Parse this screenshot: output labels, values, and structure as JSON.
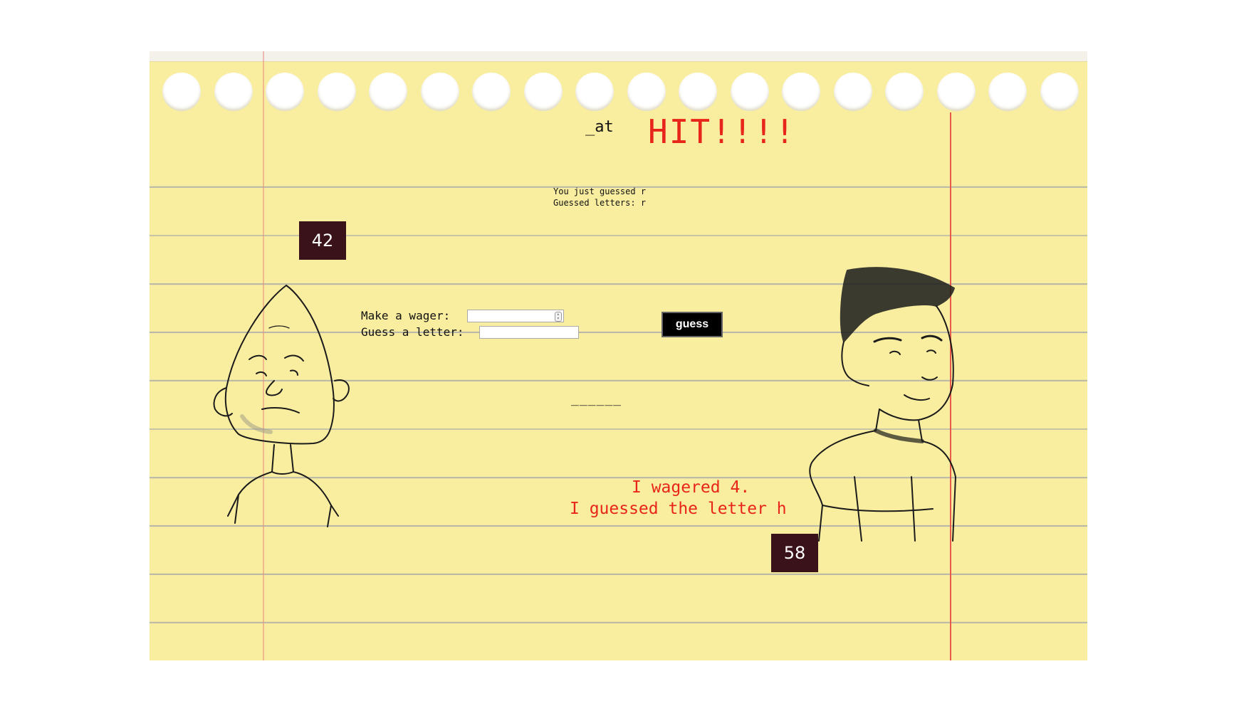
{
  "game": {
    "word_progress": "_at",
    "result_text": "HIT!!!!",
    "last_guess_text": "You just guessed r",
    "guessed_letters_text": "Guessed letters: r",
    "opponent_word_blanks": "______"
  },
  "player": {
    "score": "42",
    "character_icon": "bald-cartoon-boy-drawing"
  },
  "opponent": {
    "score": "58",
    "character_icon": "spiky-hair-cartoon-man-drawing",
    "message_line1": "I wagered 4.",
    "message_line2": "I guessed the letter h"
  },
  "form": {
    "wager_label": "Make a wager: ",
    "wager_value": "",
    "letter_label": "Guess a letter: ",
    "letter_value": "",
    "guess_button_label": "guess"
  },
  "colors": {
    "paper": "#f9ed9f",
    "hit_text": "#e8251a",
    "score_box": "#3a121a",
    "margin_line": "#e85b4b"
  }
}
